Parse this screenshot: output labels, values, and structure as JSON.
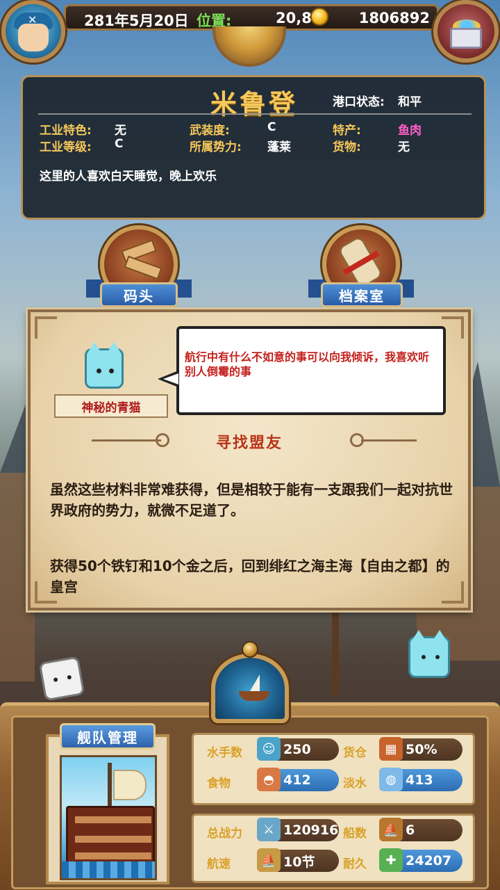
{
  "top_bar": {
    "date": "281年5月20日",
    "position_label": "位置:",
    "position_value": "20,8",
    "gold": "1806892"
  },
  "port": {
    "name": "米鲁登",
    "status_label": "港口状态:",
    "status_value": "和平",
    "stats": [
      {
        "label": "工业特色:",
        "value": "无"
      },
      {
        "label": "武装度:",
        "value": "C"
      },
      {
        "label": "特产:",
        "value": "鱼肉"
      },
      {
        "label": "工业等级:",
        "value": "C"
      },
      {
        "label": "所属势力:",
        "value": "蓬莱"
      },
      {
        "label": "货物:",
        "value": "无"
      }
    ],
    "description": "这里的人喜欢白天睡觉，晚上欢乐",
    "colors": {
      "specialty": "#ff5fc8",
      "label": "#f7c85a"
    }
  },
  "buildings": [
    {
      "label": "码头",
      "icon": "dock-icon"
    },
    {
      "label": "档案室",
      "icon": "scroll-icon"
    }
  ],
  "quest": {
    "npc_name": "神秘的青猫",
    "speech": "航行中有什么不如意的事可以向我倾诉，我喜欢听别人倒霉的事",
    "title": "寻找盟友",
    "paragraph1": "虽然这些材料非常难获得，但是相较于能有一支跟我们一起对抗世界政府的势力，就微不足道了。",
    "paragraph2": "获得50个铁钉和10个金之后，回到绯红之海主海【自由之都】的皇宫"
  },
  "fleet": {
    "title": "舰队管理",
    "stats": [
      {
        "label": "水手数",
        "value": "250",
        "icon": "sailor-icon"
      },
      {
        "label": "货仓",
        "value": "50%",
        "icon": "crate-icon"
      },
      {
        "label": "食物",
        "value": "412",
        "icon": "meat-icon"
      },
      {
        "label": "淡水",
        "value": "413",
        "icon": "water-icon"
      },
      {
        "label": "总战力",
        "value": "120916",
        "icon": "swords-icon"
      },
      {
        "label": "船数",
        "value": "6",
        "icon": "ship-count-icon"
      },
      {
        "label": "航速",
        "value": "10节",
        "icon": "sail-speed-icon"
      },
      {
        "label": "耐久",
        "value": "24207",
        "icon": "durability-icon"
      }
    ]
  }
}
